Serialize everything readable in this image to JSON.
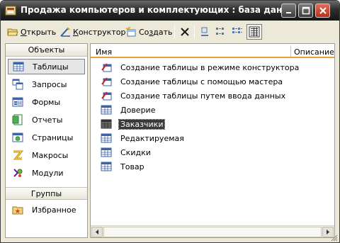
{
  "window": {
    "title": "Продажа компьютеров и комплектующих : база данных (...",
    "icon_name": "database-window-icon",
    "controls": [
      "minimize-icon",
      "maximize-icon",
      "close-icon"
    ]
  },
  "toolbar": {
    "open_prefix": "",
    "open_ul": "О",
    "open_rest": "ткрыть",
    "design_prefix": "",
    "design_ul": "К",
    "design_rest": "онструктор",
    "create_prefix": "Со",
    "create_ul": "з",
    "create_rest": "дать",
    "icons": [
      "open-icon",
      "design-icon",
      "create-icon",
      "delete-icon",
      "large-icons-view-icon",
      "small-icons-view-icon",
      "list-view-icon",
      "details-view-icon"
    ]
  },
  "nav": {
    "objects_header": "Объекты",
    "groups_header": "Группы",
    "items": [
      {
        "label": "Таблицы",
        "icon": "table-icon",
        "selected": true
      },
      {
        "label": "Запросы",
        "icon": "query-icon"
      },
      {
        "label": "Формы",
        "icon": "form-icon"
      },
      {
        "label": "Отчеты",
        "icon": "report-icon"
      },
      {
        "label": "Страницы",
        "icon": "page-icon"
      },
      {
        "label": "Макросы",
        "icon": "macro-icon"
      },
      {
        "label": "Модули",
        "icon": "module-icon"
      }
    ],
    "favorites": {
      "label": "Избранное",
      "icon": "favorites-folder-icon"
    }
  },
  "list": {
    "columns": [
      "Имя",
      "Описание"
    ],
    "items": [
      {
        "label": "Создание таблицы в режиме конструктора",
        "icon": "wizard-table-icon"
      },
      {
        "label": "Создание таблицы с помощью мастера",
        "icon": "wizard-table-icon"
      },
      {
        "label": "Создание таблицы путем ввода данных",
        "icon": "wizard-table-icon"
      },
      {
        "label": "Доверие",
        "icon": "table-icon"
      },
      {
        "label": "Заказчики",
        "icon": "table-icon",
        "selected": true
      },
      {
        "label": "Редактируемая",
        "icon": "table-icon"
      },
      {
        "label": "Скидки",
        "icon": "table-icon"
      },
      {
        "label": "Товар",
        "icon": "table-icon"
      }
    ]
  },
  "colors": {
    "header_accent": "#e9a23b",
    "titlebar": "#2e2e2e",
    "window_bg": "#ece9d8"
  }
}
